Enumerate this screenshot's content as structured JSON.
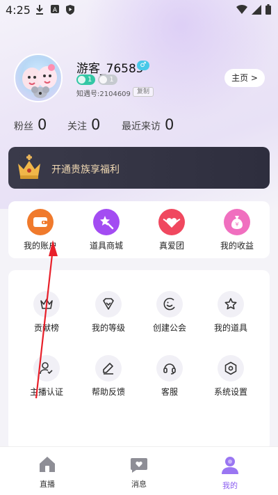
{
  "status_bar": {
    "time": "4:25"
  },
  "profile": {
    "username": "游客_76585",
    "gender_symbol": "♂",
    "level_green": "1",
    "level_gray": "1",
    "uid_text": "知遇号:2104609",
    "copy_label": "复制",
    "home_label": "主页 >"
  },
  "stats": [
    {
      "label": "粉丝",
      "value": "0"
    },
    {
      "label": "关注",
      "value": "0"
    },
    {
      "label": "最近来访",
      "value": "0"
    }
  ],
  "vip_banner": {
    "text": "开通贵族享福利"
  },
  "features": [
    {
      "label": "我的账户",
      "icon": "wallet-icon",
      "color": "#f07a2c"
    },
    {
      "label": "道具商城",
      "icon": "star-wand-icon",
      "color": "#a34cf2"
    },
    {
      "label": "真爱团",
      "icon": "winged-heart-icon",
      "color": "#f0485f"
    },
    {
      "label": "我的收益",
      "icon": "money-bag-icon",
      "color": "#f06fbf"
    }
  ],
  "grid": [
    {
      "label": "贡献榜",
      "icon": "crown-icon"
    },
    {
      "label": "我的等级",
      "icon": "level-badge-icon"
    },
    {
      "label": "创建公会",
      "icon": "smile-icon"
    },
    {
      "label": "我的道具",
      "icon": "star-icon"
    },
    {
      "label": "主播认证",
      "icon": "user-check-icon"
    },
    {
      "label": "帮助反馈",
      "icon": "edit-icon"
    },
    {
      "label": "客服",
      "icon": "headset-icon"
    },
    {
      "label": "系统设置",
      "icon": "settings-hex-icon"
    }
  ],
  "bottom_nav": [
    {
      "label": "直播",
      "icon": "home-icon",
      "active": false
    },
    {
      "label": "消息",
      "icon": "message-heart-icon",
      "active": false
    },
    {
      "label": "我的",
      "icon": "person-icon",
      "active": true
    }
  ],
  "colors": {
    "accent": "#8a5cf0",
    "annotation": "#e8202a"
  }
}
